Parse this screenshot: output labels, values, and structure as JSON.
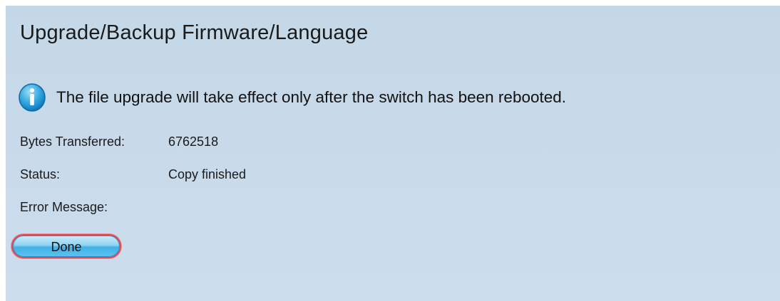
{
  "page": {
    "title": "Upgrade/Backup Firmware/Language"
  },
  "notice": {
    "icon": "info-icon",
    "text": "The file upgrade will take effect only after the switch has been rebooted."
  },
  "fields": [
    {
      "label": "Bytes Transferred:",
      "value": "6762518"
    },
    {
      "label": "Status:",
      "value": "Copy finished"
    },
    {
      "label": "Error Message:",
      "value": ""
    }
  ],
  "actions": {
    "done_label": "Done"
  },
  "colors": {
    "panel_background": "#c8d9e8",
    "button_highlight": "#d94c55",
    "info_icon": "#1a9ad9"
  }
}
